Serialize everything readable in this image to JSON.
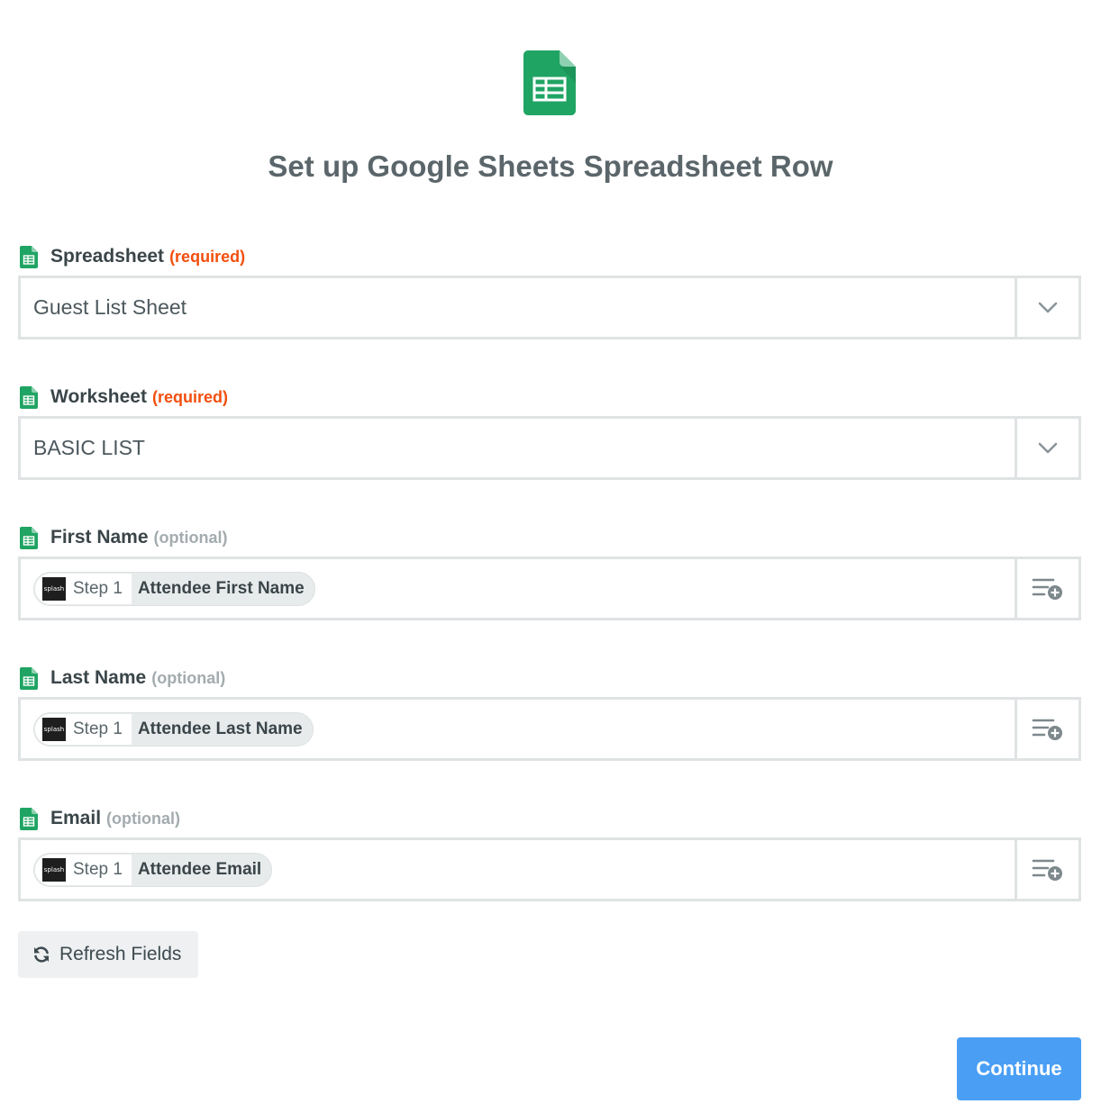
{
  "header": {
    "logo_icon": "google-sheets-icon",
    "title": "Set up Google Sheets Spreadsheet Row"
  },
  "fields": [
    {
      "label": "Spreadsheet",
      "qualifier": "(required)",
      "kind": "dropdown",
      "value": "Guest List Sheet"
    },
    {
      "label": "Worksheet",
      "qualifier": "(required)",
      "kind": "dropdown",
      "value": "BASIC LIST"
    },
    {
      "label": "First Name",
      "qualifier": "(optional)",
      "kind": "mapped",
      "step": "Step 1",
      "value": "Attendee First Name",
      "step_icon_text": "splash"
    },
    {
      "label": "Last Name",
      "qualifier": "(optional)",
      "kind": "mapped",
      "step": "Step 1",
      "value": "Attendee Last Name",
      "step_icon_text": "splash"
    },
    {
      "label": "Email",
      "qualifier": "(optional)",
      "kind": "mapped",
      "step": "Step 1",
      "value": "Attendee Email",
      "step_icon_text": "splash"
    }
  ],
  "actions": {
    "refresh_label": "Refresh Fields",
    "continue_label": "Continue"
  },
  "colors": {
    "sheets_green": "#20a464",
    "required": "#f24f0e",
    "optional": "#a3abae",
    "primary_button": "#4a9ff5"
  }
}
